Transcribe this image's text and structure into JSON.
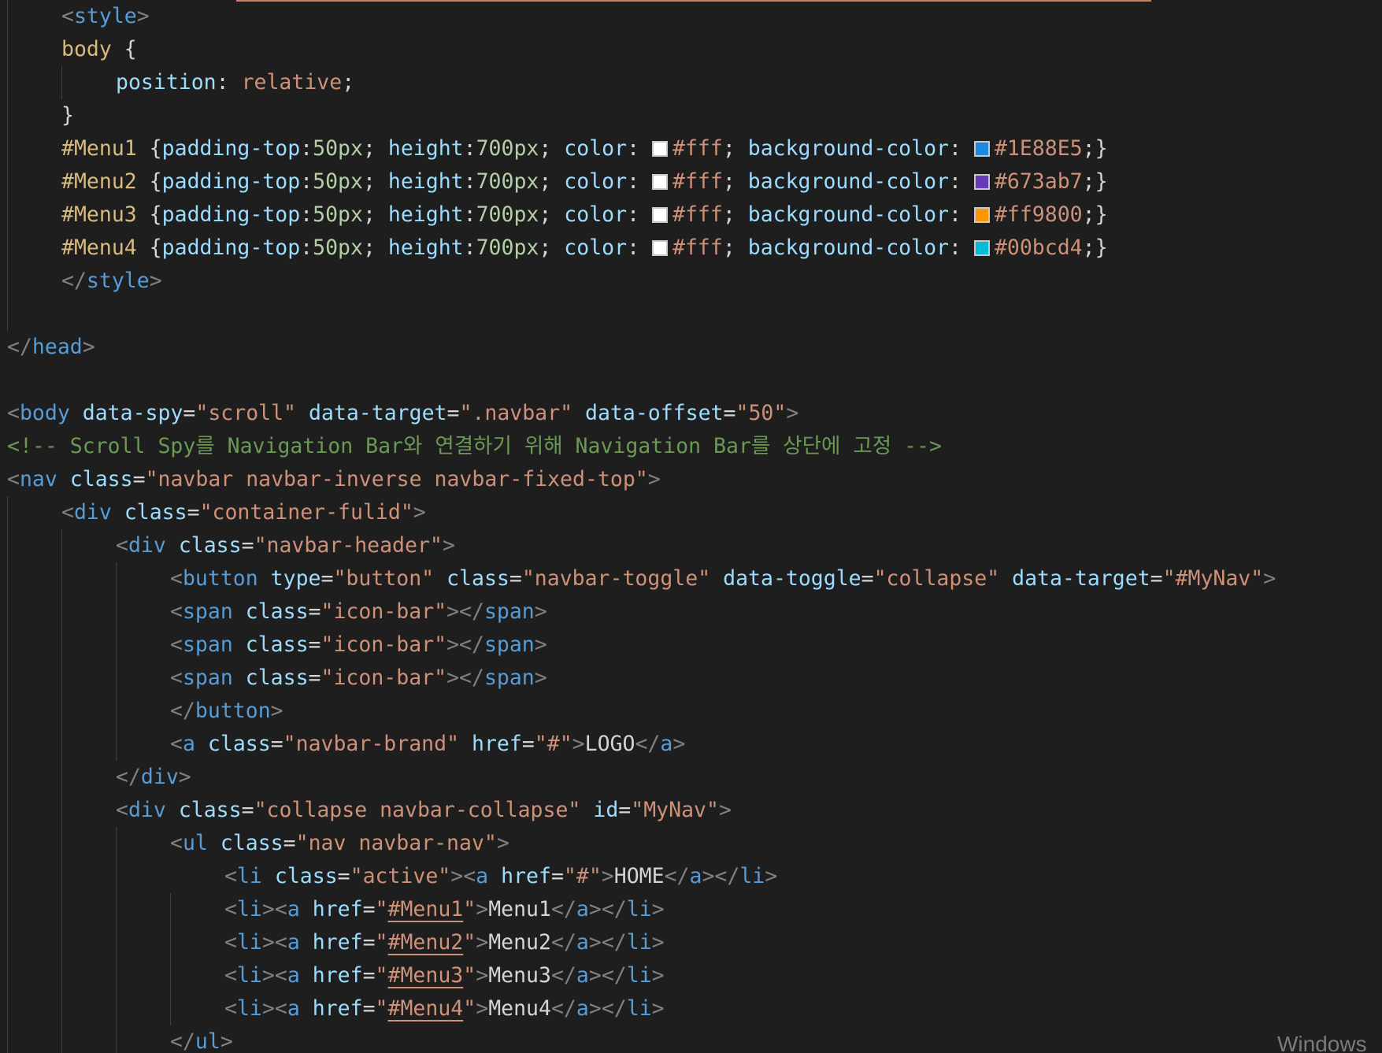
{
  "watermark_text": "Windows",
  "colors": {
    "background": "#1e1e1e",
    "punctuation": "#808080",
    "tag": "#569cd6",
    "attribute": "#9cdcfe",
    "string": "#ce9178",
    "comment": "#6a9955",
    "selector": "#d7ba7d",
    "number": "#b5cea8",
    "text": "#d4d4d4",
    "indent_guide": "#404040"
  },
  "code_lines": [
    {
      "tokens": [
        [
          "punct",
          "<"
        ],
        [
          "tag",
          "style"
        ],
        [
          "punct",
          ">"
        ]
      ]
    },
    {
      "tokens": [
        [
          "sel-tag",
          "body"
        ],
        [
          "plain",
          " {"
        ]
      ]
    },
    {
      "tokens": [
        [
          "prop",
          "position"
        ],
        [
          "plain",
          ": "
        ],
        [
          "val",
          "relative"
        ],
        [
          "plain",
          ";"
        ]
      ]
    },
    {
      "tokens": [
        [
          "plain",
          "}"
        ]
      ]
    },
    {
      "tokens": [
        [
          "sel-id",
          "#Menu1"
        ],
        [
          "plain",
          " {"
        ],
        [
          "prop",
          "padding-top"
        ],
        [
          "plain",
          ":"
        ],
        [
          "num",
          "50px"
        ],
        [
          "plain",
          "; "
        ],
        [
          "prop",
          "height"
        ],
        [
          "plain",
          ":"
        ],
        [
          "num",
          "700px"
        ],
        [
          "plain",
          "; "
        ],
        [
          "prop",
          "color"
        ],
        [
          "plain",
          ": "
        ],
        [
          "swatch",
          "#ffffff"
        ],
        [
          "val",
          "#fff"
        ],
        [
          "plain",
          "; "
        ],
        [
          "prop",
          "background-color"
        ],
        [
          "plain",
          ": "
        ],
        [
          "swatch",
          "#1E88E5"
        ],
        [
          "val",
          "#1E88E5"
        ],
        [
          "plain",
          ";}"
        ]
      ]
    },
    {
      "tokens": [
        [
          "sel-id",
          "#Menu2"
        ],
        [
          "plain",
          " {"
        ],
        [
          "prop",
          "padding-top"
        ],
        [
          "plain",
          ":"
        ],
        [
          "num",
          "50px"
        ],
        [
          "plain",
          "; "
        ],
        [
          "prop",
          "height"
        ],
        [
          "plain",
          ":"
        ],
        [
          "num",
          "700px"
        ],
        [
          "plain",
          "; "
        ],
        [
          "prop",
          "color"
        ],
        [
          "plain",
          ": "
        ],
        [
          "swatch",
          "#ffffff"
        ],
        [
          "val",
          "#fff"
        ],
        [
          "plain",
          "; "
        ],
        [
          "prop",
          "background-color"
        ],
        [
          "plain",
          ": "
        ],
        [
          "swatch",
          "#673ab7"
        ],
        [
          "val",
          "#673ab7"
        ],
        [
          "plain",
          ";}"
        ]
      ]
    },
    {
      "tokens": [
        [
          "sel-id",
          "#Menu3"
        ],
        [
          "plain",
          " {"
        ],
        [
          "prop",
          "padding-top"
        ],
        [
          "plain",
          ":"
        ],
        [
          "num",
          "50px"
        ],
        [
          "plain",
          "; "
        ],
        [
          "prop",
          "height"
        ],
        [
          "plain",
          ":"
        ],
        [
          "num",
          "700px"
        ],
        [
          "plain",
          "; "
        ],
        [
          "prop",
          "color"
        ],
        [
          "plain",
          ": "
        ],
        [
          "swatch",
          "#ffffff"
        ],
        [
          "val",
          "#fff"
        ],
        [
          "plain",
          "; "
        ],
        [
          "prop",
          "background-color"
        ],
        [
          "plain",
          ": "
        ],
        [
          "swatch",
          "#ff9800"
        ],
        [
          "val",
          "#ff9800"
        ],
        [
          "plain",
          ";}"
        ]
      ]
    },
    {
      "tokens": [
        [
          "sel-id",
          "#Menu4"
        ],
        [
          "plain",
          " {"
        ],
        [
          "prop",
          "padding-top"
        ],
        [
          "plain",
          ":"
        ],
        [
          "num",
          "50px"
        ],
        [
          "plain",
          "; "
        ],
        [
          "prop",
          "height"
        ],
        [
          "plain",
          ":"
        ],
        [
          "num",
          "700px"
        ],
        [
          "plain",
          "; "
        ],
        [
          "prop",
          "color"
        ],
        [
          "plain",
          ": "
        ],
        [
          "swatch",
          "#ffffff"
        ],
        [
          "val",
          "#fff"
        ],
        [
          "plain",
          "; "
        ],
        [
          "prop",
          "background-color"
        ],
        [
          "plain",
          ": "
        ],
        [
          "swatch",
          "#00bcd4"
        ],
        [
          "val",
          "#00bcd4"
        ],
        [
          "plain",
          ";}"
        ]
      ]
    },
    {
      "tokens": [
        [
          "punct",
          "</"
        ],
        [
          "tag",
          "style"
        ],
        [
          "punct",
          ">"
        ]
      ]
    },
    {
      "tokens": []
    },
    {
      "tokens": [
        [
          "punct",
          "</"
        ],
        [
          "tag",
          "head"
        ],
        [
          "punct",
          ">"
        ]
      ]
    },
    {
      "tokens": []
    },
    {
      "tokens": [
        [
          "punct",
          "<"
        ],
        [
          "tag",
          "body"
        ],
        [
          "plain",
          " "
        ],
        [
          "attr",
          "data-spy"
        ],
        [
          "plain",
          "="
        ],
        [
          "str",
          "\"scroll\""
        ],
        [
          "plain",
          " "
        ],
        [
          "attr",
          "data-target"
        ],
        [
          "plain",
          "="
        ],
        [
          "str",
          "\".navbar\""
        ],
        [
          "plain",
          " "
        ],
        [
          "attr",
          "data-offset"
        ],
        [
          "plain",
          "="
        ],
        [
          "str",
          "\"50\""
        ],
        [
          "punct",
          ">"
        ]
      ]
    },
    {
      "tokens": [
        [
          "comment",
          "<!-- Scroll Spy를 Navigation Bar와 연결하기 위해 Navigation Bar를 상단에 고정 -->"
        ]
      ]
    },
    {
      "tokens": [
        [
          "punct",
          "<"
        ],
        [
          "tag",
          "nav"
        ],
        [
          "plain",
          " "
        ],
        [
          "attr",
          "class"
        ],
        [
          "plain",
          "="
        ],
        [
          "str",
          "\"navbar navbar-inverse navbar-fixed-top\""
        ],
        [
          "punct",
          ">"
        ]
      ]
    },
    {
      "tokens": [
        [
          "punct",
          "<"
        ],
        [
          "tag",
          "div"
        ],
        [
          "plain",
          " "
        ],
        [
          "attr",
          "class"
        ],
        [
          "plain",
          "="
        ],
        [
          "str",
          "\"container-fulid\""
        ],
        [
          "punct",
          ">"
        ]
      ]
    },
    {
      "tokens": [
        [
          "punct",
          "<"
        ],
        [
          "tag",
          "div"
        ],
        [
          "plain",
          " "
        ],
        [
          "attr",
          "class"
        ],
        [
          "plain",
          "="
        ],
        [
          "str",
          "\"navbar-header\""
        ],
        [
          "punct",
          ">"
        ]
      ]
    },
    {
      "tokens": [
        [
          "punct",
          "<"
        ],
        [
          "tag",
          "button"
        ],
        [
          "plain",
          " "
        ],
        [
          "attr",
          "type"
        ],
        [
          "plain",
          "="
        ],
        [
          "str",
          "\"button\""
        ],
        [
          "plain",
          " "
        ],
        [
          "attr",
          "class"
        ],
        [
          "plain",
          "="
        ],
        [
          "str",
          "\"navbar-toggle\""
        ],
        [
          "plain",
          " "
        ],
        [
          "attr",
          "data-toggle"
        ],
        [
          "plain",
          "="
        ],
        [
          "str",
          "\"collapse\""
        ],
        [
          "plain",
          " "
        ],
        [
          "attr",
          "data-target"
        ],
        [
          "plain",
          "="
        ],
        [
          "str",
          "\"#MyNav\""
        ],
        [
          "punct",
          ">"
        ]
      ]
    },
    {
      "tokens": [
        [
          "punct",
          "<"
        ],
        [
          "tag",
          "span"
        ],
        [
          "plain",
          " "
        ],
        [
          "attr",
          "class"
        ],
        [
          "plain",
          "="
        ],
        [
          "str",
          "\"icon-bar\""
        ],
        [
          "punct",
          "></"
        ],
        [
          "tag",
          "span"
        ],
        [
          "punct",
          ">"
        ]
      ]
    },
    {
      "tokens": [
        [
          "punct",
          "<"
        ],
        [
          "tag",
          "span"
        ],
        [
          "plain",
          " "
        ],
        [
          "attr",
          "class"
        ],
        [
          "plain",
          "="
        ],
        [
          "str",
          "\"icon-bar\""
        ],
        [
          "punct",
          "></"
        ],
        [
          "tag",
          "span"
        ],
        [
          "punct",
          ">"
        ]
      ]
    },
    {
      "tokens": [
        [
          "punct",
          "<"
        ],
        [
          "tag",
          "span"
        ],
        [
          "plain",
          " "
        ],
        [
          "attr",
          "class"
        ],
        [
          "plain",
          "="
        ],
        [
          "str",
          "\"icon-bar\""
        ],
        [
          "punct",
          "></"
        ],
        [
          "tag",
          "span"
        ],
        [
          "punct",
          ">"
        ]
      ]
    },
    {
      "tokens": [
        [
          "punct",
          "</"
        ],
        [
          "tag",
          "button"
        ],
        [
          "punct",
          ">"
        ]
      ]
    },
    {
      "tokens": [
        [
          "punct",
          "<"
        ],
        [
          "tag",
          "a"
        ],
        [
          "plain",
          " "
        ],
        [
          "attr",
          "class"
        ],
        [
          "plain",
          "="
        ],
        [
          "str",
          "\"navbar-brand\""
        ],
        [
          "plain",
          " "
        ],
        [
          "attr",
          "href"
        ],
        [
          "plain",
          "="
        ],
        [
          "str",
          "\"#\""
        ],
        [
          "punct",
          ">"
        ],
        [
          "text",
          "LOGO"
        ],
        [
          "punct",
          "</"
        ],
        [
          "tag",
          "a"
        ],
        [
          "punct",
          ">"
        ]
      ]
    },
    {
      "tokens": [
        [
          "punct",
          "</"
        ],
        [
          "tag",
          "div"
        ],
        [
          "punct",
          ">"
        ]
      ]
    },
    {
      "tokens": [
        [
          "punct",
          "<"
        ],
        [
          "tag",
          "div"
        ],
        [
          "plain",
          " "
        ],
        [
          "attr",
          "class"
        ],
        [
          "plain",
          "="
        ],
        [
          "str",
          "\"collapse navbar-collapse\""
        ],
        [
          "plain",
          " "
        ],
        [
          "attr",
          "id"
        ],
        [
          "plain",
          "="
        ],
        [
          "str",
          "\"MyNav\""
        ],
        [
          "punct",
          ">"
        ]
      ]
    },
    {
      "tokens": [
        [
          "punct",
          "<"
        ],
        [
          "tag",
          "ul"
        ],
        [
          "plain",
          " "
        ],
        [
          "attr",
          "class"
        ],
        [
          "plain",
          "="
        ],
        [
          "str",
          "\"nav navbar-nav\""
        ],
        [
          "punct",
          ">"
        ]
      ]
    },
    {
      "tokens": [
        [
          "punct",
          "<"
        ],
        [
          "tag",
          "li"
        ],
        [
          "plain",
          " "
        ],
        [
          "attr",
          "class"
        ],
        [
          "plain",
          "="
        ],
        [
          "str",
          "\"active\""
        ],
        [
          "punct",
          "><"
        ],
        [
          "tag",
          "a"
        ],
        [
          "plain",
          " "
        ],
        [
          "attr",
          "href"
        ],
        [
          "plain",
          "="
        ],
        [
          "str",
          "\"#\""
        ],
        [
          "punct",
          ">"
        ],
        [
          "text",
          "HOME"
        ],
        [
          "punct",
          "</"
        ],
        [
          "tag",
          "a"
        ],
        [
          "punct",
          "></"
        ],
        [
          "tag",
          "li"
        ],
        [
          "punct",
          ">"
        ]
      ]
    },
    {
      "tokens": [
        [
          "punct",
          "<"
        ],
        [
          "tag",
          "li"
        ],
        [
          "punct",
          "><"
        ],
        [
          "tag",
          "a"
        ],
        [
          "plain",
          " "
        ],
        [
          "attr",
          "href"
        ],
        [
          "plain",
          "="
        ],
        [
          "str",
          "\""
        ],
        [
          "link",
          "#Menu1"
        ],
        [
          "str",
          "\""
        ],
        [
          "punct",
          ">"
        ],
        [
          "text",
          "Menu1"
        ],
        [
          "punct",
          "</"
        ],
        [
          "tag",
          "a"
        ],
        [
          "punct",
          "></"
        ],
        [
          "tag",
          "li"
        ],
        [
          "punct",
          ">"
        ]
      ]
    },
    {
      "tokens": [
        [
          "punct",
          "<"
        ],
        [
          "tag",
          "li"
        ],
        [
          "punct",
          "><"
        ],
        [
          "tag",
          "a"
        ],
        [
          "plain",
          " "
        ],
        [
          "attr",
          "href"
        ],
        [
          "plain",
          "="
        ],
        [
          "str",
          "\""
        ],
        [
          "link",
          "#Menu2"
        ],
        [
          "str",
          "\""
        ],
        [
          "punct",
          ">"
        ],
        [
          "text",
          "Menu2"
        ],
        [
          "punct",
          "</"
        ],
        [
          "tag",
          "a"
        ],
        [
          "punct",
          "></"
        ],
        [
          "tag",
          "li"
        ],
        [
          "punct",
          ">"
        ]
      ]
    },
    {
      "tokens": [
        [
          "punct",
          "<"
        ],
        [
          "tag",
          "li"
        ],
        [
          "punct",
          "><"
        ],
        [
          "tag",
          "a"
        ],
        [
          "plain",
          " "
        ],
        [
          "attr",
          "href"
        ],
        [
          "plain",
          "="
        ],
        [
          "str",
          "\""
        ],
        [
          "link",
          "#Menu3"
        ],
        [
          "str",
          "\""
        ],
        [
          "punct",
          ">"
        ],
        [
          "text",
          "Menu3"
        ],
        [
          "punct",
          "</"
        ],
        [
          "tag",
          "a"
        ],
        [
          "punct",
          "></"
        ],
        [
          "tag",
          "li"
        ],
        [
          "punct",
          ">"
        ]
      ]
    },
    {
      "tokens": [
        [
          "punct",
          "<"
        ],
        [
          "tag",
          "li"
        ],
        [
          "punct",
          "><"
        ],
        [
          "tag",
          "a"
        ],
        [
          "plain",
          " "
        ],
        [
          "attr",
          "href"
        ],
        [
          "plain",
          "="
        ],
        [
          "str",
          "\""
        ],
        [
          "link",
          "#Menu4"
        ],
        [
          "str",
          "\""
        ],
        [
          "punct",
          ">"
        ],
        [
          "text",
          "Menu4"
        ],
        [
          "punct",
          "</"
        ],
        [
          "tag",
          "a"
        ],
        [
          "punct",
          "></"
        ],
        [
          "tag",
          "li"
        ],
        [
          "punct",
          ">"
        ]
      ]
    },
    {
      "tokens": [
        [
          "punct",
          "</"
        ],
        [
          "tag",
          "ul"
        ],
        [
          "punct",
          ">"
        ]
      ]
    }
  ]
}
